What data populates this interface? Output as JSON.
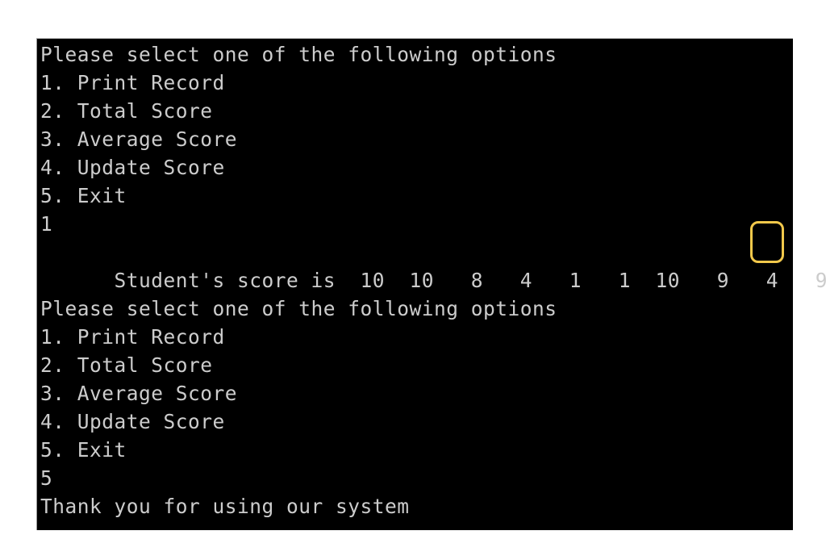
{
  "console": {
    "lines": [
      "Please select one of the following options",
      "1. Print Record",
      "2. Total Score",
      "3. Average Score",
      "4. Update Score",
      "5. Exit",
      "1",
      "Student's score is  10  10   8   4   1   1  10   9   4   9",
      "",
      "Please select one of the following options",
      "1. Print Record",
      "2. Total Score",
      "3. Average Score",
      "4. Update Score",
      "5. Exit",
      "5",
      "Thank you for using our system"
    ],
    "scores": [
      10,
      10,
      8,
      4,
      1,
      1,
      10,
      9,
      4,
      9
    ],
    "highlighted_score": "9",
    "highlight_color": "#f2c84b"
  }
}
